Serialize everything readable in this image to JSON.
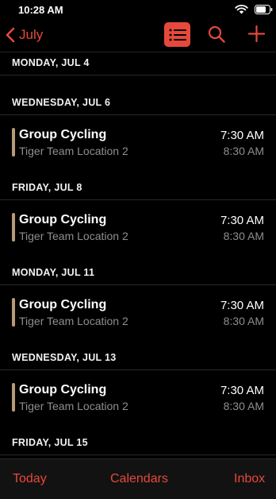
{
  "status_bar": {
    "time": "10:28 AM",
    "wifi_icon": "wifi-icon",
    "battery_icon": "battery-icon"
  },
  "nav": {
    "back_label": "July",
    "list_icon": "list-icon",
    "search_icon": "search-icon",
    "add_icon": "plus-icon"
  },
  "days": [
    {
      "header": "MONDAY, JUL 4",
      "events": []
    },
    {
      "header": "WEDNESDAY, JUL 6",
      "events": [
        {
          "title": "Group Cycling",
          "location": "Tiger Team Location 2",
          "start": "7:30 AM",
          "end": "8:30 AM"
        }
      ]
    },
    {
      "header": "FRIDAY, JUL 8",
      "events": [
        {
          "title": "Group Cycling",
          "location": "Tiger Team Location 2",
          "start": "7:30 AM",
          "end": "8:30 AM"
        }
      ]
    },
    {
      "header": "MONDAY, JUL 11",
      "events": [
        {
          "title": "Group Cycling",
          "location": "Tiger Team Location 2",
          "start": "7:30 AM",
          "end": "8:30 AM"
        }
      ]
    },
    {
      "header": "WEDNESDAY, JUL 13",
      "events": [
        {
          "title": "Group Cycling",
          "location": "Tiger Team Location 2",
          "start": "7:30 AM",
          "end": "8:30 AM"
        }
      ]
    },
    {
      "header": "FRIDAY, JUL 15",
      "events": []
    }
  ],
  "tab_bar": {
    "today": "Today",
    "calendars": "Calendars",
    "inbox": "Inbox"
  },
  "colors": {
    "accent": "#e5493b",
    "event_bar": "#b89a78",
    "secondary_text": "#8e8e93"
  }
}
